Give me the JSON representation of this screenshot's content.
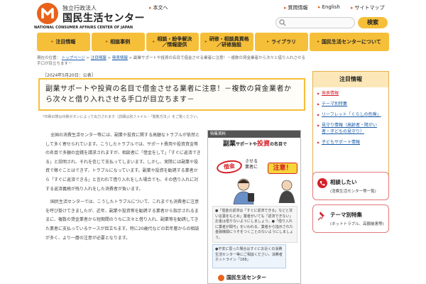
{
  "header": {
    "org_small": "独立行政法人",
    "org_name": "国民生活センター",
    "org_en": "NATIONAL CONSUMER AFFAIRS CENTER OF JAPAN",
    "links": [
      {
        "label": "本文へ"
      },
      {
        "label": "質問情報"
      },
      {
        "label": "English"
      },
      {
        "label": "サイトマップ"
      }
    ],
    "search_placeholder": "",
    "search_button": "検索"
  },
  "nav": [
    {
      "label": "注目情報"
    },
    {
      "label": "相談事例"
    },
    {
      "label": "相談・紛争解決\n／情報提供"
    },
    {
      "label": "研修・相談員資格\n／研修施設"
    },
    {
      "label": "ライブラリ"
    },
    {
      "label": "国民生活センターについて"
    }
  ],
  "breadcrumb": {
    "prefix": "現在の位置：",
    "items": [
      "トップページ",
      "注目情報",
      "発表情報",
      "副業サポートや投資の名目で借金させる業者に注意！－複数の貸金業者から次々と借り入れさせる手口が目立ちます－"
    ]
  },
  "article": {
    "date": "［2024年5月20日：公表］",
    "title": "副業サポートや投資の名目で借金させる業者に注意！－複数の貸金業者から次々と借り入れさせる手口が目立ちます－",
    "note": "*印刷の際は印刷ボタンによって出力されます（詳細は別ファイル・「閲覧方法」）をご覧ください。",
    "paragraphs": [
      "全国の消費生活センター等には、副業や投資に関する高額なトラブルが依然として多く寄せられています。こうしたトラブルでは、サポート費用や投資資金等の名目で多額の金銭を請求されますが、相談者に「借金をして」「すぐに返済できる」と説明され、それを信じて支払ってしまいます。しかし、実際には副業や投資で稼ぐことはできず、トラブルになっています。副業や投資を勧誘する業者から「すぐに返済できる」と言われて借り入れをした場合でも、その借り入れに対する返済義務が残り入れをした消費者が負います。",
      "国民生活センターでは、こうしたトラブルについて、これまでも消費者に注意を呼び掛けてきましたが、近年、副業や投資等を勧誘する業者から指示されるままに、複数の貸金業者から短期間のうちに次々と借り入れ、副業等を勧誘してきた業者に支払っているケースが目立ちます。特に20歳代などの若年層からの相談が多く、より一層の注意が必要となります。"
    ]
  },
  "figure": {
    "header": "特集資料",
    "title_pre": "副業",
    "title_mid": "サポートや",
    "title_em": "投資",
    "title_post": "の名目で",
    "stamp": "借金",
    "sub": "させる\n業者に",
    "caution": "注意！",
    "box1": "●「借金の返済は「すぐに返済できる」などと甘い言葉をもとめ」業者がいても「返済できない」お金は借りないようにしましょう。●「借り入れに業者が関与」をいわれる、業者から指示された金融機関にうそをつくことのないようにしましょう。",
    "box2": "●不安に思った場合はすぐにお近くの消費生活センター等にご相談ください。消費者ホットライン「188」",
    "footer": "国民生活センター"
  },
  "sidebar": {
    "title": "注目情報",
    "items": [
      "発表情報",
      "テーマ別特集",
      "リーフレット「くらしの危険」",
      "見守り情報（高齢者・障がい者・子どもの見守り）",
      "子どもサポート情報"
    ]
  },
  "cta": [
    {
      "title": "相談したい",
      "sub": "(消費生活センター等一覧)"
    },
    {
      "title": "テーマ別特集",
      "sub": "(ネットトラブル、高額被害等)"
    }
  ],
  "colors": {
    "brand": "#e8621b",
    "nav": "#f6bf3a",
    "accent": "#d4222b",
    "link": "#1a5ba8"
  }
}
